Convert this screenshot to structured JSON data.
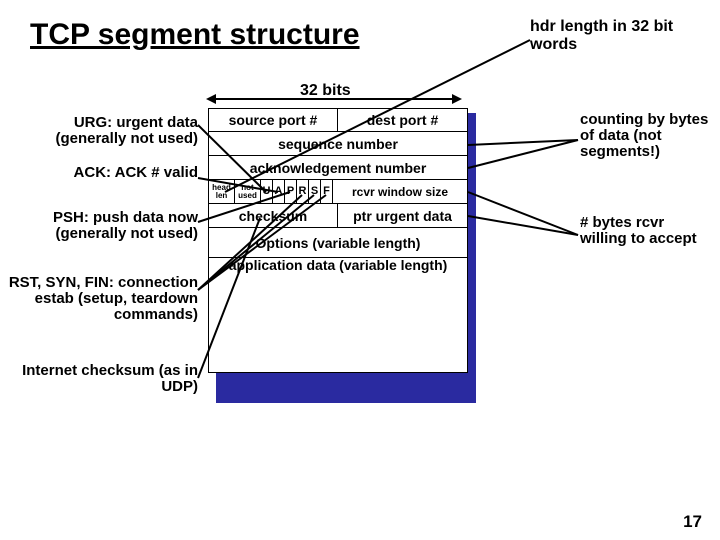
{
  "title": "TCP segment structure",
  "hdr_note": "hdr length in 32 bit words",
  "bits_label": "32 bits",
  "left": {
    "urg": "URG: urgent data (generally not used)",
    "ack": "ACK: ACK # valid",
    "psh": "PSH: push data now (generally not used)",
    "rst": "RST, SYN, FIN: connection estab (setup, teardown commands)",
    "chk": "Internet checksum (as in UDP)"
  },
  "right": {
    "count": "counting by bytes of data (not segments!)",
    "win": "# bytes rcvr willing to accept"
  },
  "seg": {
    "src": "source port #",
    "dst": "dest port #",
    "seq": "sequence number",
    "ack": "acknowledgement number",
    "headlen": "head len",
    "notused": "not used",
    "flags": [
      "U",
      "A",
      "P",
      "R",
      "S",
      "F"
    ],
    "win": "rcvr window size",
    "chk": "checksum",
    "urg": "ptr urgent data",
    "opts": "Options (variable length)",
    "data": "application data (variable length)"
  },
  "page": "17"
}
